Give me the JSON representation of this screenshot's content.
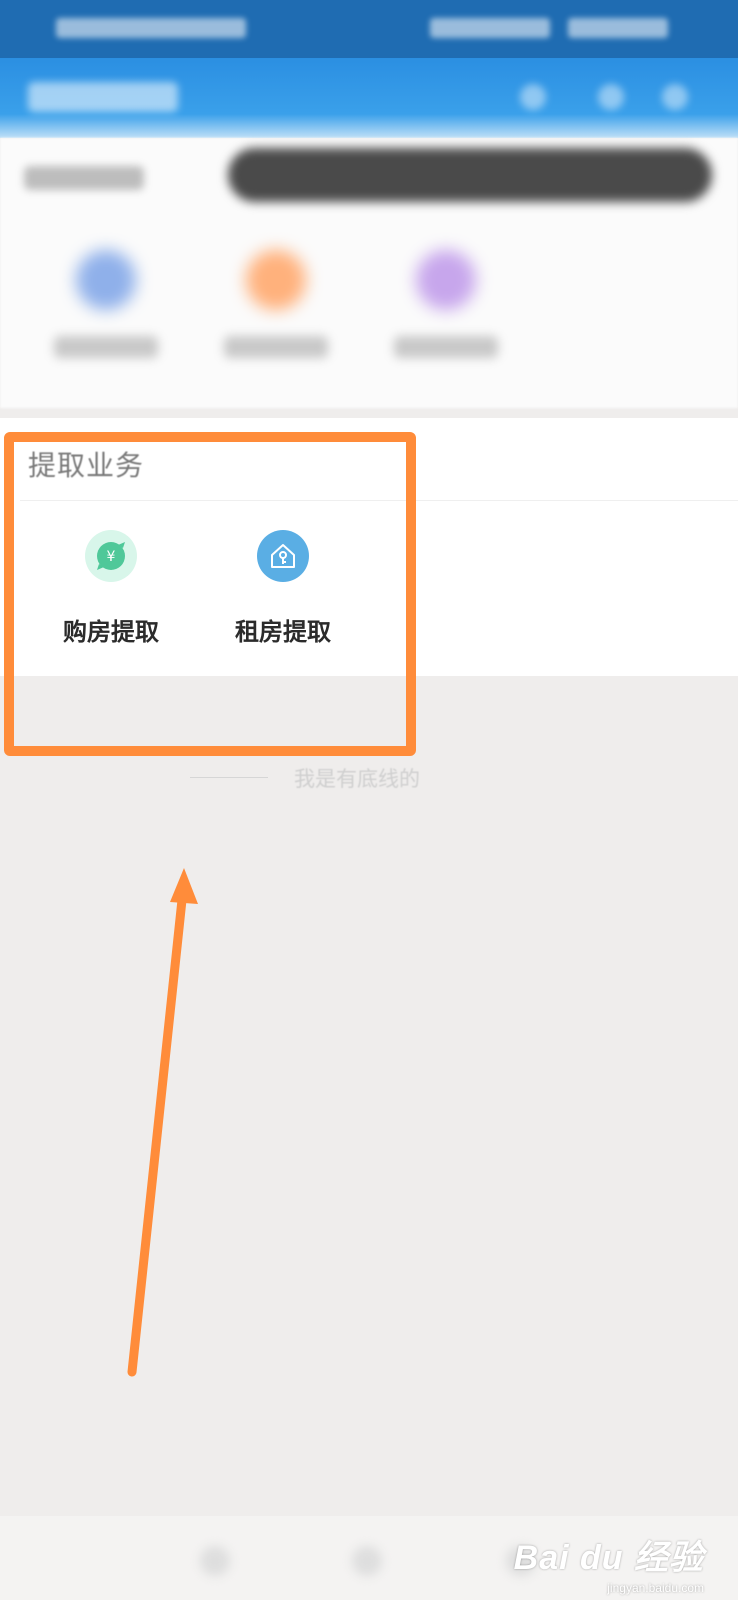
{
  "section": {
    "title": "提取业务"
  },
  "business_items": [
    {
      "label": "购房提取",
      "icon": "yuan-chat-icon",
      "icon_color": "#4fc899",
      "icon_bg": "#d8f6ea"
    },
    {
      "label": "租房提取",
      "icon": "house-key-icon",
      "icon_color": "#5aaee4"
    }
  ],
  "footer_note": {
    "text": "我是有底线的"
  },
  "watermark": {
    "brand": "Bai du 经验",
    "url": "jingyan.baidu.com"
  },
  "colors": {
    "highlight": "#ff8c3a",
    "header_blue": "#2b8fe2",
    "page_bg": "#efedec"
  }
}
